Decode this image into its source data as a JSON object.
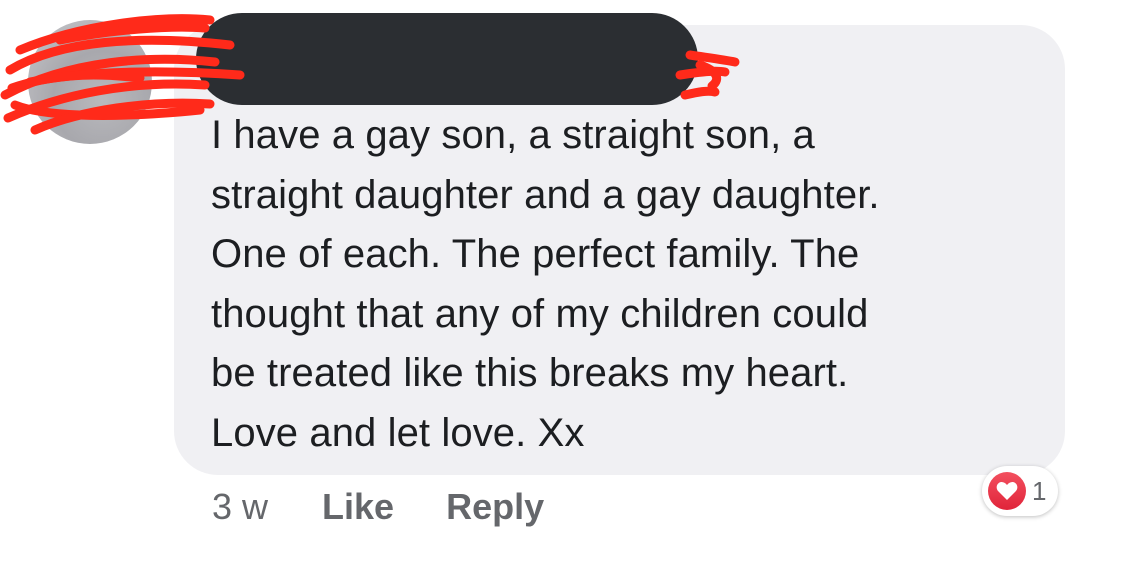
{
  "comment": {
    "lines": [
      "I have a gay son, a straight son, a",
      "straight daughter and a gay daughter.",
      "One of each. The perfect family. The",
      "thought that any of my children could",
      "be treated like this breaks my heart.",
      "Love and let love. Xx"
    ]
  },
  "actions": {
    "time": "3 w",
    "like_label": "Like",
    "reply_label": "Reply"
  },
  "reactions": {
    "icon": "heart-icon",
    "count": "1",
    "color": "#e0243a"
  },
  "colors": {
    "bubble": "#f0f0f3",
    "redaction": "#2b2e32",
    "scribble": "#ff2a1a"
  }
}
